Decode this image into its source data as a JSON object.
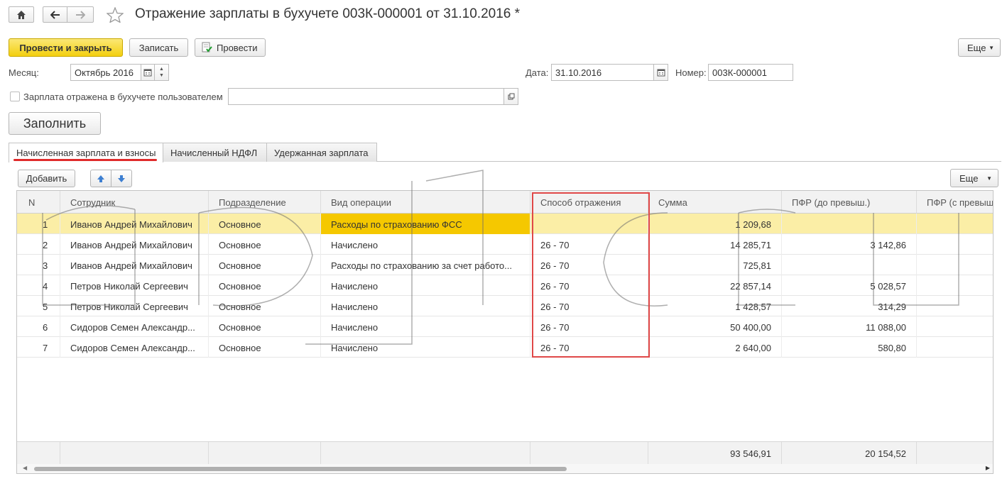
{
  "window": {
    "title": "Отражение зарплаты в бухучете 003К-000001 от 31.10.2016 *"
  },
  "toolbar": {
    "post_close": "Провести и закрыть",
    "save": "Записать",
    "post": "Провести",
    "more": "Еще"
  },
  "form": {
    "month_label": "Месяц:",
    "month_value": "Октябрь 2016",
    "date_label": "Дата:",
    "date_value": "31.10.2016",
    "number_label": "Номер:",
    "number_value": "003К-000001",
    "checkbox_label": "Зарплата отражена в бухучете пользователем",
    "fill_button": "Заполнить"
  },
  "tabs": [
    {
      "label": "Начисленная зарплата и взносы",
      "active": true
    },
    {
      "label": "Начисленный НДФЛ",
      "active": false
    },
    {
      "label": "Удержанная зарплата",
      "active": false
    }
  ],
  "table_toolbar": {
    "add": "Добавить",
    "more": "Еще"
  },
  "table": {
    "columns": [
      "N",
      "Сотрудник",
      "Подразделение",
      "Вид операции",
      "Способ отражения",
      "Сумма",
      "ПФР (до превыш.)",
      "ПФР (с превыш"
    ],
    "rows": [
      {
        "n": "1",
        "employee": "Иванов Андрей Михайлович",
        "dept": "Основное",
        "op": "Расходы по страхованию ФСС",
        "method": "",
        "sum": "1 209,68",
        "pfr": ""
      },
      {
        "n": "2",
        "employee": "Иванов Андрей Михайлович",
        "dept": "Основное",
        "op": "Начислено",
        "method": "26 - 70",
        "sum": "14 285,71",
        "pfr": "3 142,86"
      },
      {
        "n": "3",
        "employee": "Иванов Андрей Михайлович",
        "dept": "Основное",
        "op": "Расходы по страхованию за счет работо...",
        "method": "26 - 70",
        "sum": "725,81",
        "pfr": ""
      },
      {
        "n": "4",
        "employee": "Петров Николай Сергеевич",
        "dept": "Основное",
        "op": "Начислено",
        "method": "26 - 70",
        "sum": "22 857,14",
        "pfr": "5 028,57"
      },
      {
        "n": "5",
        "employee": "Петров Николай Сергеевич",
        "dept": "Основное",
        "op": "Начислено",
        "method": "26 - 70",
        "sum": "1 428,57",
        "pfr": "314,29"
      },
      {
        "n": "6",
        "employee": "Сидоров Семен Александр...",
        "dept": "Основное",
        "op": "Начислено",
        "method": "26 - 70",
        "sum": "50 400,00",
        "pfr": "11 088,00"
      },
      {
        "n": "7",
        "employee": "Сидоров Семен Александр...",
        "dept": "Основное",
        "op": "Начислено",
        "method": "26 - 70",
        "sum": "2 640,00",
        "pfr": "580,80"
      }
    ],
    "totals": {
      "sum": "93 546,91",
      "pfr": "20 154,52"
    }
  },
  "colors": {
    "primary_button": "#f5d12a",
    "selected_row": "#fbeea6",
    "highlight_cell": "#f5c800",
    "annotation_red": "#e04848"
  }
}
